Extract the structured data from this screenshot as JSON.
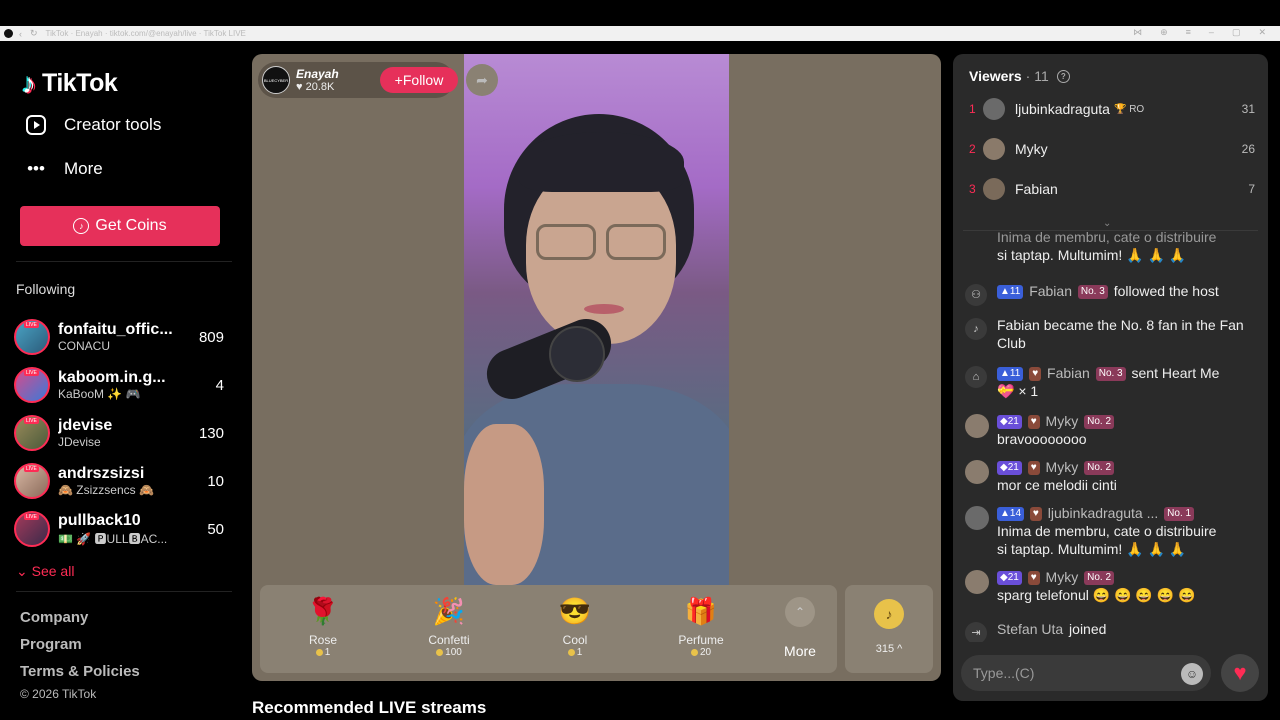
{
  "browser": {
    "url_text": "TikTok · Enayah · tiktok.com/@enayah/live · TikTok LIVE"
  },
  "sidebar": {
    "logo_word": "TikTok",
    "items": [
      {
        "label": "Creator tools",
        "icon": "creator-tools-icon"
      },
      {
        "label": "More",
        "icon": "more-dots-icon"
      }
    ],
    "get_coins_label": "Get Coins",
    "following_heading": "Following",
    "following": [
      {
        "name": "fonfaitu_offic...",
        "sub": "CONACU",
        "count": "809"
      },
      {
        "name": "kaboom.in.g...",
        "sub": "KaBooM ✨ 🎮",
        "count": "4"
      },
      {
        "name": "jdevise",
        "sub": "JDevise",
        "count": "130"
      },
      {
        "name": "andrszsizsi",
        "sub": "🙈 Zsizzsencs 🙈",
        "count": "10"
      },
      {
        "name": "pullback10",
        "sub": "💵 🚀 🅿ULL🅱AC...",
        "count": "50"
      }
    ],
    "see_all": "See all",
    "footer": [
      "Company",
      "Program",
      "Terms & Policies"
    ],
    "copyright": "© 2026 TikTok"
  },
  "stream": {
    "host_name": "Enayah",
    "host_likes": "20.8K",
    "follow_label": "Follow",
    "gifts": [
      {
        "name": "Rose",
        "price": "1",
        "icon": "rose-icon",
        "glyph": "🌹"
      },
      {
        "name": "Confetti",
        "price": "100",
        "icon": "confetti-icon",
        "glyph": "🎉"
      },
      {
        "name": "Cool",
        "price": "1",
        "icon": "cool-face-icon",
        "glyph": "😎"
      },
      {
        "name": "Perfume",
        "price": "20",
        "icon": "perfume-icon",
        "glyph": "🎁"
      }
    ],
    "more_label": "More",
    "coin_count": "315",
    "recommended_title": "Recommended LIVE streams"
  },
  "chat": {
    "viewers_label": "Viewers",
    "viewers_count": "· 11",
    "top_viewers": [
      {
        "rank": "1",
        "name": "ljubinkadraguta",
        "tag": "🏆 RO",
        "score": "31"
      },
      {
        "rank": "2",
        "name": "Myky",
        "tag": "",
        "score": "26"
      },
      {
        "rank": "3",
        "name": "Fabian",
        "tag": "",
        "score": "7"
      }
    ],
    "messages": {
      "m0_text": "Inima de membru, cate o distribuire",
      "m0_text2": "si taptap. Multumim! 🙏 🙏 🙏",
      "m1_level": "11",
      "m1_user": "Fabian",
      "m1_no": "No. 3",
      "m1_text": "followed the host",
      "m2_text": "Fabian became the No. 8 fan in the Fan Club",
      "m3_level": "11",
      "m3_user": "Fabian",
      "m3_no": "No. 3",
      "m3_text": "sent Heart Me",
      "m3_count": "× 1",
      "m4_level": "21",
      "m4_user": "Myky",
      "m4_no": "No. 2",
      "m4_text": "bravoooooooo",
      "m5_level": "21",
      "m5_user": "Myky",
      "m5_no": "No. 2",
      "m5_text": "mor ce melodii cinti",
      "m6_level": "14",
      "m6_user": "ljubinkadraguta ...",
      "m6_no": "No. 1",
      "m6_text": "Inima de membru, cate o distribuire",
      "m6_text2": "si taptap. Multumim! 🙏 🙏 🙏",
      "m7_level": "21",
      "m7_user": "Myky",
      "m7_no": "No. 2",
      "m7_text": "sparg telefonul 😄 😄 😄 😄 😄",
      "m8_user": "Stefan Uta",
      "m8_text": "joined"
    },
    "input_placeholder": "Type...(C)"
  }
}
